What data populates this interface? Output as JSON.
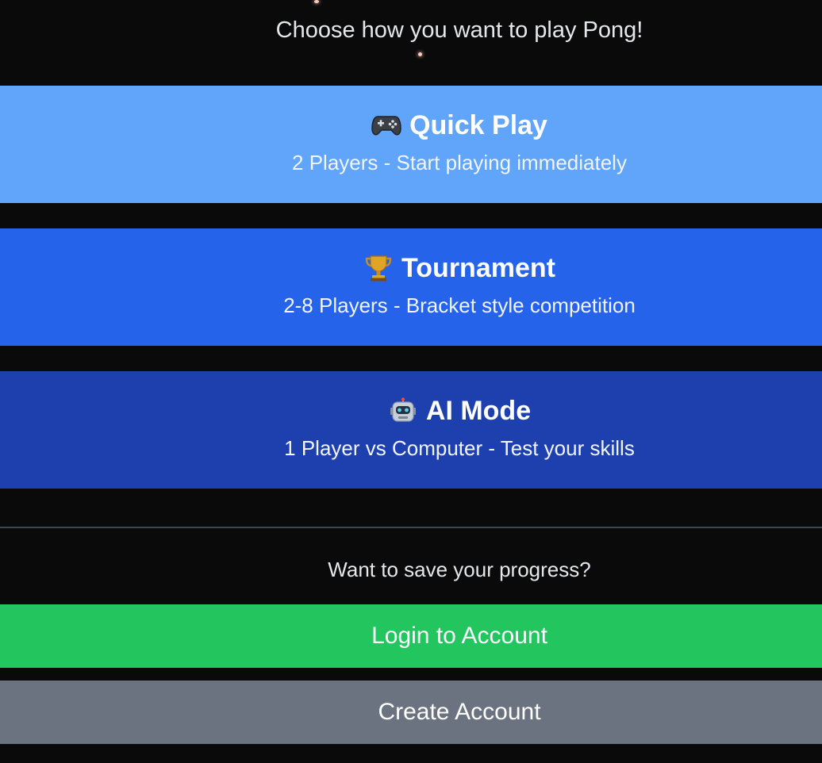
{
  "subtitle": "Choose how you want to play Pong!",
  "modes": {
    "quick_play": {
      "icon": "game-controller-icon",
      "title": "Quick Play",
      "description": "2 Players - Start playing immediately",
      "color": "#60a5fa"
    },
    "tournament": {
      "icon": "trophy-icon",
      "title": "Tournament",
      "description": "2-8 Players - Bracket style competition",
      "color": "#2563eb"
    },
    "ai_mode": {
      "icon": "robot-icon",
      "title": "AI Mode",
      "description": "1 Player vs Computer - Test your skills",
      "color": "#1e40af"
    }
  },
  "account": {
    "prompt": "Want to save your progress?",
    "login_label": "Login to Account",
    "login_color": "#22c55e",
    "create_label": "Create Account",
    "create_color": "#6b7280"
  }
}
